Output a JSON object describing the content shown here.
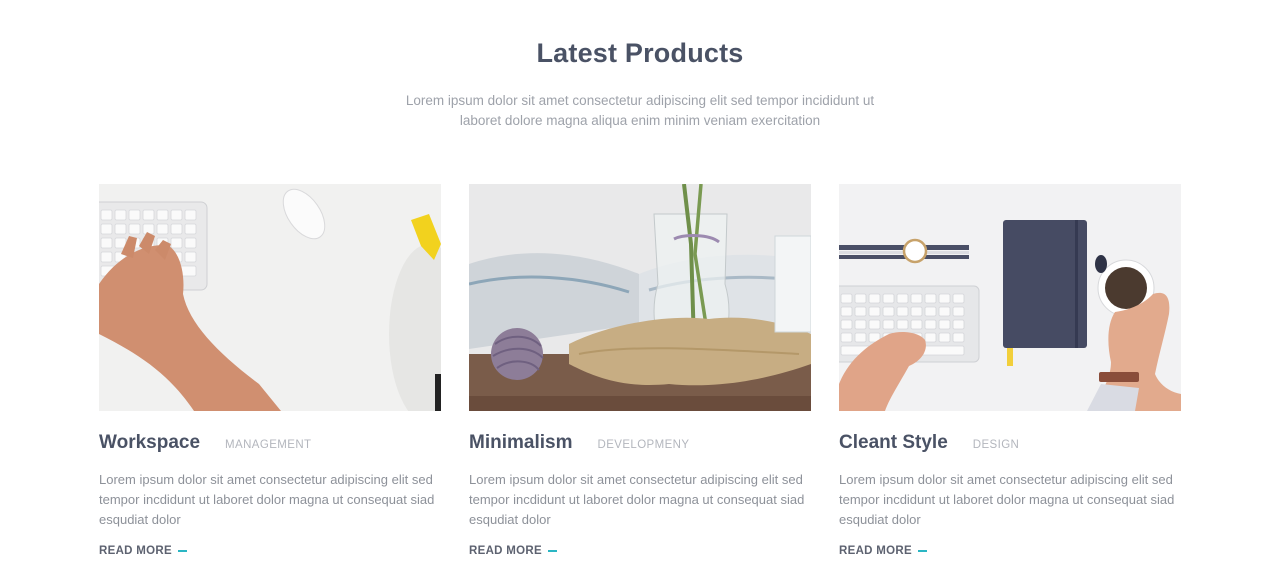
{
  "section": {
    "title": "Latest Products",
    "subtitle": "Lorem ipsum dolor sit amet consectetur adipiscing elit sed tempor incididunt ut laboret dolore magna aliqua enim minim veniam exercitation"
  },
  "cards": [
    {
      "title": "Workspace",
      "category": "MANAGEMENT",
      "text": "Lorem ipsum dolor sit amet consectetur adipiscing elit sed tempor incdidunt ut laboret dolor magna ut consequat siad esqudiat dolor",
      "read_more": "READ MORE",
      "image_icon": "keyboard-hand-photo"
    },
    {
      "title": "Minimalism",
      "category": "DEVELOPMENY",
      "text": "Lorem ipsum dolor sit amet consectetur adipiscing elit sed tempor incdidunt ut laboret dolor magna ut consequat siad esqudiat dolor",
      "read_more": "READ MORE",
      "image_icon": "vase-book-photo"
    },
    {
      "title": "Cleant Style",
      "category": "DESIGN",
      "text": "Lorem ipsum dolor sit amet consectetur adipiscing elit sed tempor incdidunt ut laboret dolor magna ut consequat siad esqudiat dolor",
      "read_more": "READ MORE",
      "image_icon": "notebook-coffee-photo"
    }
  ],
  "colors": {
    "accent": "#2bb6c4",
    "heading": "#4a5265",
    "muted": "#9ea2aa"
  }
}
